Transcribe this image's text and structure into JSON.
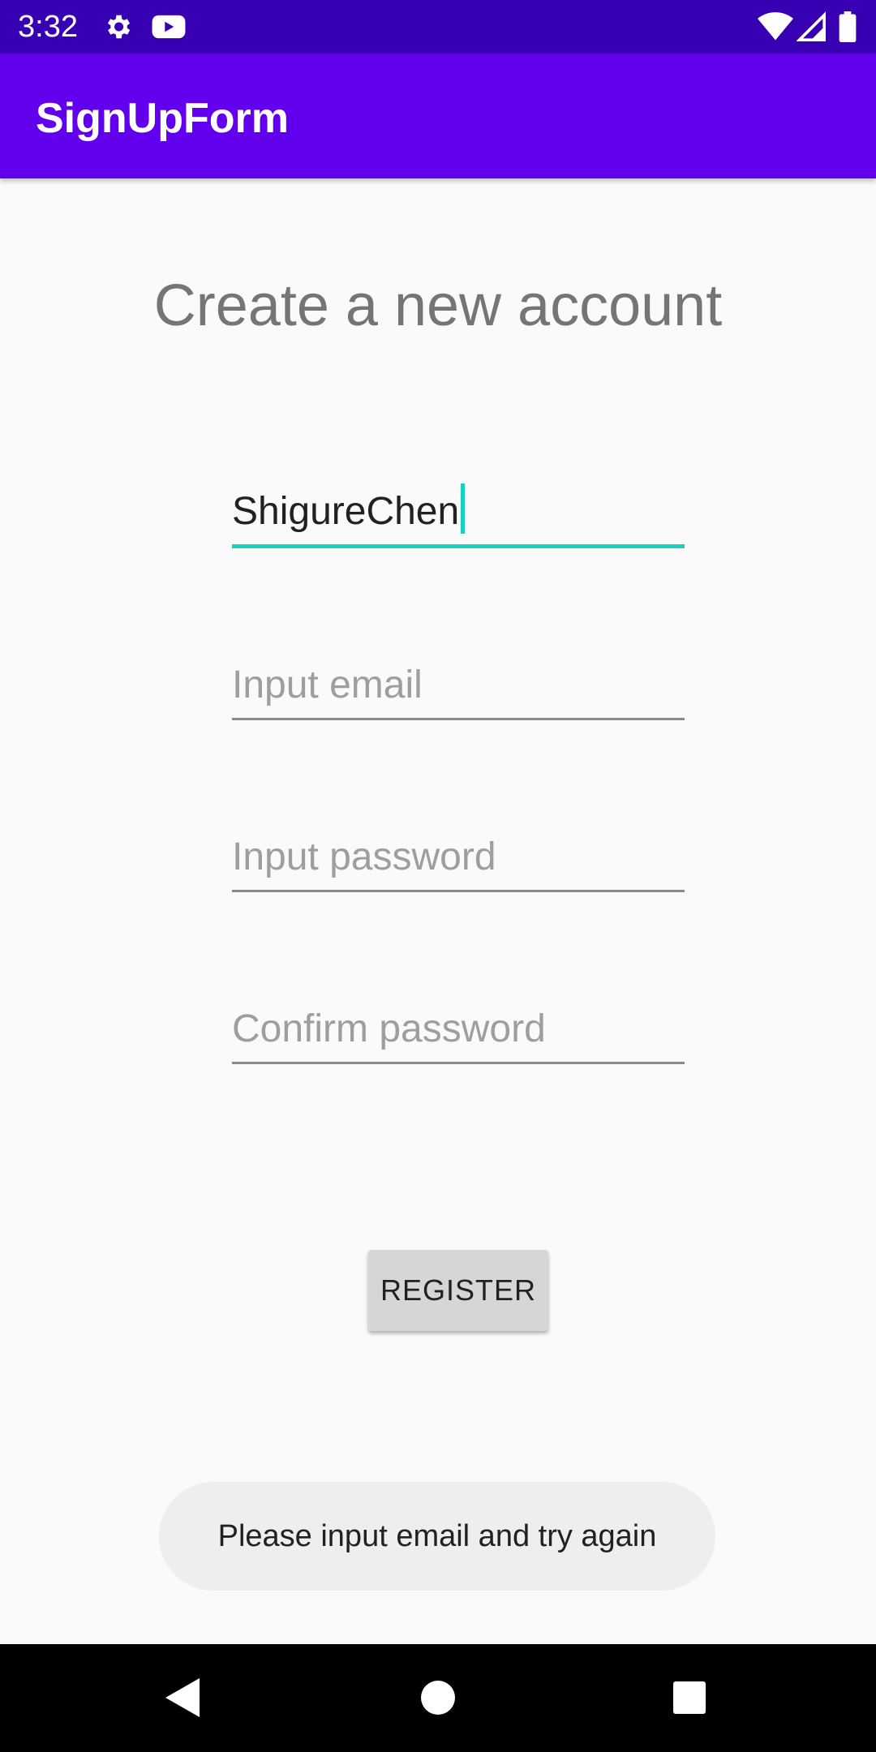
{
  "status_bar": {
    "time": "3:32",
    "icons_left": [
      "gear-icon",
      "youtube-icon"
    ],
    "icons_right": [
      "wifi-icon",
      "cellular-signal-icon",
      "battery-icon"
    ]
  },
  "app_bar": {
    "title": "SignUpForm"
  },
  "form": {
    "heading": "Create a new account",
    "username": {
      "value": "ShigureChen",
      "focused": true
    },
    "email": {
      "value": "",
      "placeholder": "Input email"
    },
    "password": {
      "value": "",
      "placeholder": "Input password"
    },
    "confirm_password": {
      "value": "",
      "placeholder": "Confirm password"
    },
    "register_label": "REGISTER"
  },
  "toast": {
    "message": "Please input email and try again"
  },
  "nav_bar": {
    "icons": [
      "back-icon",
      "home-icon",
      "recents-icon"
    ]
  },
  "colors": {
    "status_bar": "#3700b3",
    "app_bar": "#6200ee",
    "focus_accent": "#1ad1c0"
  }
}
